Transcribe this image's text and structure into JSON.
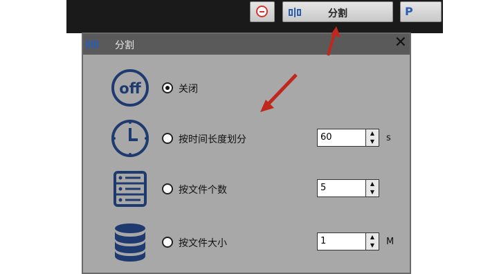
{
  "toolbar": {
    "split_button_label": "分割",
    "extra_button_label": "P"
  },
  "dialog": {
    "title": "分割",
    "close_label": "✕",
    "options": [
      {
        "id": "off",
        "label": "关闭",
        "selected": true,
        "icon": "power-off-icon"
      },
      {
        "id": "by-time",
        "label": "按时间长度划分",
        "selected": false,
        "icon": "clock-icon",
        "value": "60",
        "unit": "s"
      },
      {
        "id": "by-count",
        "label": "按文件个数",
        "selected": false,
        "icon": "list-icon",
        "value": "5"
      },
      {
        "id": "by-size",
        "label": "按文件大小",
        "selected": false,
        "icon": "database-icon",
        "value": "1",
        "unit": "M"
      }
    ]
  },
  "colors": {
    "icon_blue": "#1e3a6e",
    "dialog_bg": "#a8a8a8",
    "titlebar_bg": "#5a5a5a",
    "annotation_red": "#c0281e"
  }
}
